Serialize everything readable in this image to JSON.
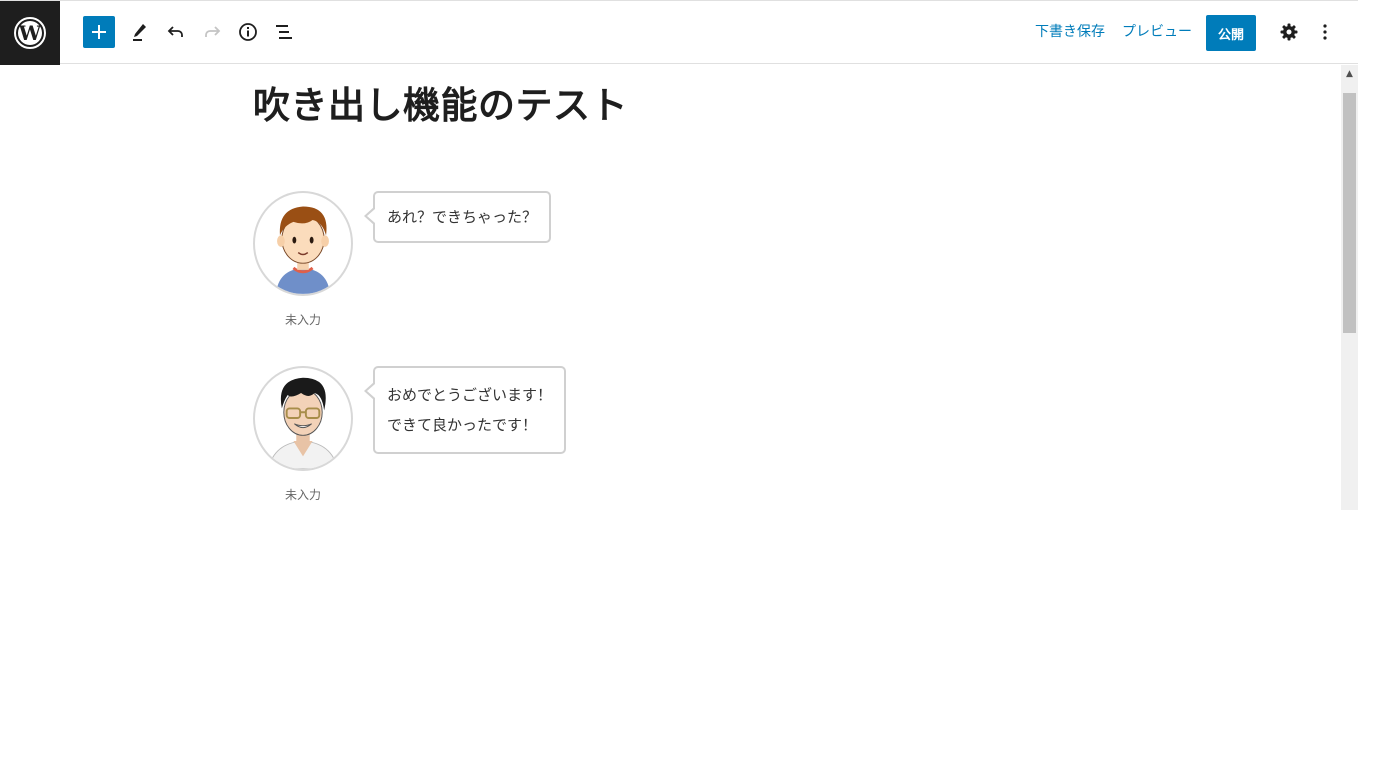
{
  "toolbar": {
    "logo_icon": "wordpress-logo-icon",
    "add_icon": "plus-icon",
    "edit_icon": "pencil-icon",
    "undo_icon": "undo-icon",
    "redo_icon": "redo-icon",
    "info_icon": "info-icon",
    "list_icon": "list-view-icon",
    "save_draft_label": "下書き保存",
    "preview_label": "プレビュー",
    "publish_label": "公開",
    "settings_icon": "gear-icon",
    "more_icon": "more-vertical-icon",
    "accent_color": "#007cba"
  },
  "post": {
    "title": "吹き出し機能のテスト",
    "balloons": [
      {
        "speaker_name": "未入力",
        "lines": [
          "あれ？できちゃった？"
        ]
      },
      {
        "speaker_name": "未入力",
        "lines": [
          "おめでとうございます！",
          "できて良かったです！"
        ]
      }
    ]
  }
}
